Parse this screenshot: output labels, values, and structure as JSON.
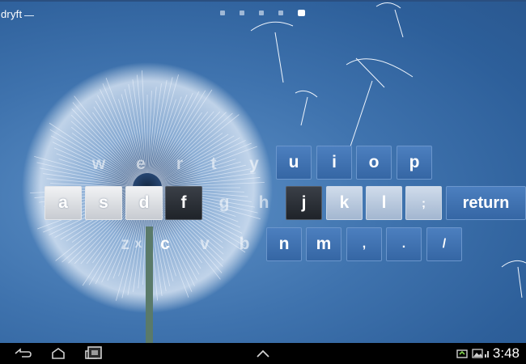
{
  "app": {
    "label": "dryft"
  },
  "pager": {
    "count": 5,
    "active_index": 4
  },
  "keyboard": {
    "row1": [
      "w",
      "e",
      "r",
      "t",
      "y",
      "u",
      "i",
      "o",
      "p"
    ],
    "row2": [
      "a",
      "s",
      "d",
      "f",
      "g",
      "h",
      "j",
      "k",
      "l",
      ";"
    ],
    "row3": [
      "z",
      "x",
      "c",
      "v",
      "b",
      "n",
      "m",
      ",",
      ".",
      "/"
    ],
    "return_label": "return",
    "pressed_keys": [
      "f",
      "j"
    ]
  },
  "navbar": {
    "icons": [
      "back-icon",
      "home-icon",
      "recent-apps-icon",
      "screenshot-icon",
      "chevron-up-icon",
      "usb-icon",
      "picture-icon",
      "signal-icon",
      "battery-icon"
    ],
    "time": "3:48"
  },
  "colors": {
    "background": "#3f73ae",
    "key_blue": "#3c6eae",
    "navbar": "#000000"
  }
}
